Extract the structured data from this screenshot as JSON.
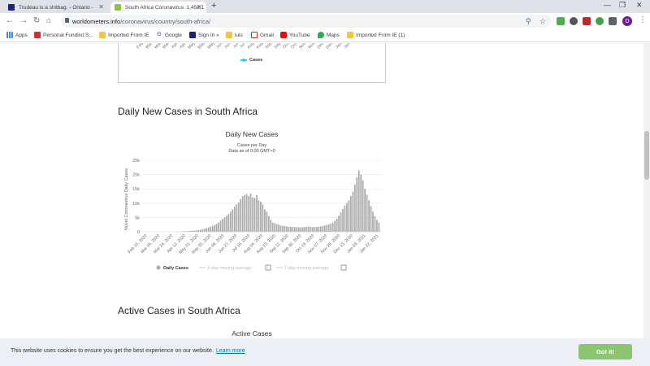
{
  "tabs": [
    {
      "title": "Trudeau is a shitbag. - Ontario - ",
      "favicon_color": "#1a237e"
    },
    {
      "title": "South Africa Coronavirus: 1,458,1",
      "favicon_color": "#8bc34a"
    }
  ],
  "address_bar": {
    "domain": "worldometers.info",
    "path": "/coronavirus/country/south-africa/"
  },
  "bookmarks": [
    {
      "label": "Apps",
      "icon": "apps-grid-icon"
    },
    {
      "label": "Personal Fundlist S...",
      "icon": "maple-leaf-icon"
    },
    {
      "label": "Imported From IE",
      "icon": "folder-icon"
    },
    {
      "label": "Google",
      "icon": "google-g-icon"
    },
    {
      "label": "Sign In »",
      "icon": "signin-star-icon"
    },
    {
      "label": "luis",
      "icon": "folder-icon"
    },
    {
      "label": "Gmail",
      "icon": "gmail-icon"
    },
    {
      "label": "YouTube",
      "icon": "youtube-icon"
    },
    {
      "label": "Maps",
      "icon": "maps-pin-icon"
    },
    {
      "label": "Imported From IE (1)",
      "icon": "folder-icon"
    }
  ],
  "previous_chart": {
    "x_ticks": [
      "Feb",
      "Mar",
      "Mar",
      "Mar",
      "Apr",
      "Apr",
      "May",
      "May",
      "May",
      "Jun",
      "Jun",
      "Jul",
      "Jul",
      "Aug",
      "Aug",
      "Sep",
      "Sep",
      "Oct",
      "Oct",
      "Nov",
      "Nov",
      "Dec",
      "Dec",
      "Jan",
      "Jan"
    ],
    "legend": "Cases"
  },
  "section1": {
    "heading": "Daily New Cases in South Africa"
  },
  "chart1": {
    "title": "Daily New Cases",
    "subtitle1": "Cases per Day",
    "subtitle2": "Data as of 0:00 GMT+0",
    "ylabel": "Novel Coronavirus Daily Cases",
    "legend_daily": "Daily Cases",
    "legend_3day": "3-day moving average",
    "legend_7day": "7-day moving average"
  },
  "chart_data": {
    "type": "bar",
    "title": "Daily New Cases",
    "subtitle": "Cases per Day / Data as of 0:00 GMT+0",
    "xlabel": "",
    "ylabel": "Novel Coronavirus Daily Cases",
    "ylim": [
      0,
      25000
    ],
    "y_ticks": [
      "0",
      "5k",
      "10k",
      "15k",
      "20k",
      "25k"
    ],
    "y_tick_values": [
      0,
      5000,
      10000,
      15000,
      20000,
      25000
    ],
    "x_tick_labels": [
      "Feb 15, 2020",
      "Mar 05, 2020",
      "Mar 24, 2020",
      "Apr 12, 2020",
      "May 01, 2020",
      "May 20, 2020",
      "Jun 08, 2020",
      "Jun 27, 2020",
      "Jul 16, 2020",
      "Aug 04, 2020",
      "Aug 23, 2020",
      "Sep 11, 2020",
      "Sep 30, 2020",
      "Oct 19, 2020",
      "Nov 07, 2020",
      "Nov 26, 2020",
      "Dec 15, 2020",
      "Jan 03, 2021",
      "Jan 22, 2021"
    ],
    "series": [
      {
        "name": "Daily Cases",
        "color": "#aaaaaa",
        "values": [
          0,
          0,
          0,
          0,
          0,
          0,
          0,
          0,
          0,
          0,
          0,
          0,
          0,
          0,
          0,
          0,
          10,
          30,
          80,
          100,
          150,
          200,
          250,
          300,
          350,
          400,
          500,
          600,
          700,
          900,
          1100,
          1300,
          1500,
          1800,
          2000,
          2400,
          2800,
          3300,
          3900,
          4500,
          5000,
          5600,
          6200,
          7000,
          7800,
          8800,
          9600,
          10200,
          11500,
          12500,
          12800,
          13200,
          12500,
          13300,
          12000,
          11800,
          12800,
          11000,
          10500,
          9600,
          7800,
          7000,
          5600,
          4200,
          3200,
          3000,
          2700,
          2500,
          2200,
          2100,
          2000,
          1900,
          1800,
          1750,
          1700,
          1650,
          1600,
          1600,
          1550,
          1600,
          1650,
          1700,
          1800,
          1700,
          1600,
          1700,
          1750,
          1800,
          1900,
          2000,
          2200,
          2400,
          2600,
          2800,
          3200,
          3800,
          4600,
          5600,
          6800,
          8000,
          9200,
          10000,
          11000,
          12500,
          14000,
          16500,
          19000,
          21500,
          20000,
          18000,
          15000,
          13000,
          11000,
          9000,
          7000,
          5500,
          4200,
          3200
        ]
      },
      {
        "name": "3-day moving average",
        "color": "#cccccc",
        "values": []
      },
      {
        "name": "7-day moving average",
        "color": "#cccccc",
        "values": []
      }
    ]
  },
  "section2": {
    "heading": "Active Cases in South Africa"
  },
  "chart2": {
    "title": "Active Cases"
  },
  "cookie_banner": {
    "message": "This website uses cookies to ensure you get the best experience on our website.",
    "link": "Learn more",
    "button": "Got it!"
  },
  "colors": {
    "accent_green": "#8ac56f",
    "link_blue": "#0073ce",
    "bar_gray": "#aaaaaa",
    "legend_cyan": "#33ccff"
  }
}
